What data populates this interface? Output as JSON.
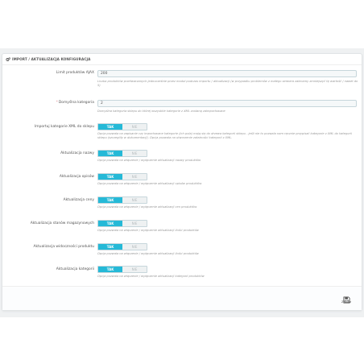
{
  "panel": {
    "title": "IMPORT / AKTUALIZACJA KONFIGURACJA",
    "title_icon": "cogs-icon"
  },
  "fields": {
    "limit": {
      "label": "Limit produktów AJAX",
      "value": "200",
      "help": "Liczba produktów przetwarzanych jednocześnie przez moduł podczas importu / aktualizacji (w przypadku problemów z małego serwera zalecamy zmniejszyć tę wartość / nawet do 5)"
    },
    "category": {
      "required_mark": "*",
      "label": "Domyślna kategoria",
      "value": "2",
      "help": "Domyślna kategoria sklepu do której wszystkie kategorie z XML zostaną zaimportowane"
    },
    "import_categories": {
      "label": "Importuj kategorie XML do sklepu",
      "on": "TAK",
      "off": "NIE",
      "help": "Opcja pozwala na zapisanie czy importowane kategorie (ich pola) mają się do drzewa kategorii sklepu - jeśli nie to pozwala nam ręcznie przypisać kategorie z XML do kategorii sklepu (szczegóły w dokumentacji). Opcja pozwala na utworzenie zależności kategorii z XML."
    },
    "update_name": {
      "label": "Aktualizacja nazwy",
      "on": "TAK",
      "off": "NIE",
      "help": "Opcja pozwala na włączenie / wyłączenie aktualizacji nazwy produktów"
    },
    "update_desc": {
      "label": "Aktualizacja opisów",
      "on": "TAK",
      "off": "NIE",
      "help": "Opcja pozwala na włączenie / wyłączenie aktualizacji opisów produktów"
    },
    "update_price": {
      "label": "Aktualizacja ceny",
      "on": "TAK",
      "off": "NIE",
      "help": "Opcja pozwala na włączenie / wyłączenie aktualizacji cen produktów"
    },
    "update_stock": {
      "label": "Aktualizacja stanów magazynowych",
      "on": "TAK",
      "off": "NIE",
      "help": "Opcja pozwala na włączenie / wyłączenie aktualizacji ilości produktów"
    },
    "update_visibility": {
      "label": "Aktualizacja widoczności produktu",
      "on": "TAK",
      "off": "NIE",
      "help": "Opcja pozwala na włączenie / wyłączenie aktualizacji ilości produktów"
    },
    "update_categories": {
      "label": "Aktualizacja kategorii",
      "on": "TAK",
      "off": "NIE",
      "help": "Opcja pozwala na włączenie / wyłączenie aktualizacji kategorii produktów"
    }
  },
  "footer": {
    "save_label": "Zapisz",
    "save_icon": "floppy-disk-icon"
  },
  "colors": {
    "accent": "#25b9d7",
    "required": "#e08f95"
  }
}
